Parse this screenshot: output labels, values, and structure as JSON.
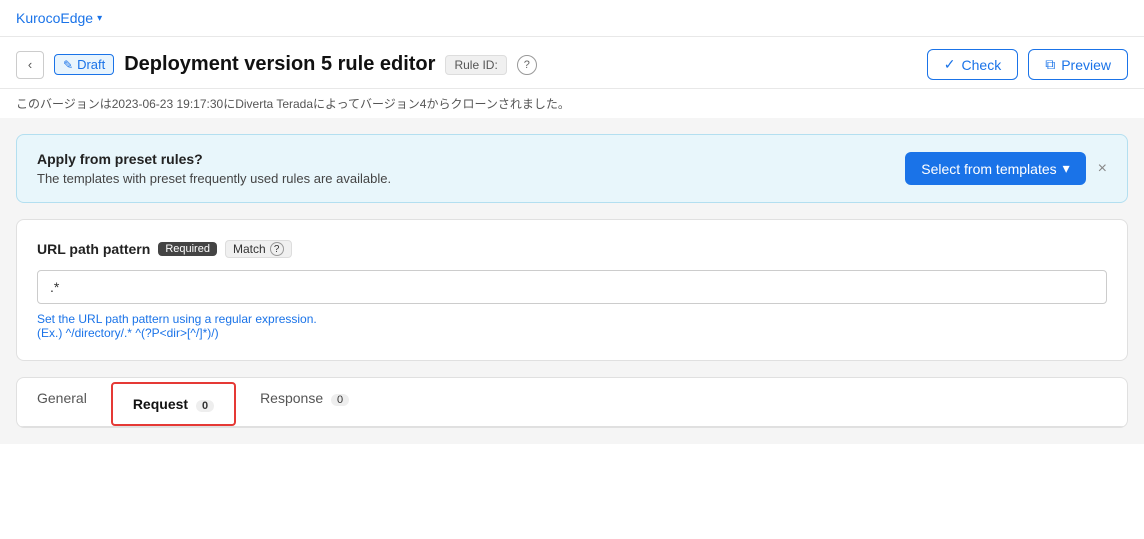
{
  "brand": {
    "name": "KurocoEdge",
    "chevron": "▾"
  },
  "header": {
    "back_label": "‹",
    "draft_label": "Draft",
    "draft_icon": "✎",
    "title": "Deployment version 5 rule editor",
    "rule_id_label": "Rule ID:",
    "help_icon": "?",
    "check_label": "Check",
    "check_icon": "✓",
    "preview_label": "Preview",
    "preview_icon": "⧉"
  },
  "version_info": "このバージョンは2023-06-23 19:17:30にDiverta Teradaによってバージョン4からクローンされました。",
  "template_banner": {
    "heading": "Apply from preset rules?",
    "description": "The templates with preset frequently used rules are available.",
    "select_btn_label": "Select from templates",
    "select_btn_chevron": "▾",
    "close_icon": "×"
  },
  "url_pattern": {
    "label": "URL path pattern",
    "required_badge": "Required",
    "match_label": "Match",
    "help_icon": "?",
    "input_value": ".*",
    "hint_line1": "Set the URL path pattern using a regular expression.",
    "hint_line2": "(Ex.)  ^/directory/.*   ^(?P<dir>[^/]*)/)"
  },
  "tabs": [
    {
      "id": "general",
      "label": "General",
      "badge": null,
      "active": false,
      "highlighted": false
    },
    {
      "id": "request",
      "label": "Request",
      "badge": "0",
      "active": false,
      "highlighted": true
    },
    {
      "id": "response",
      "label": "Response",
      "badge": "0",
      "active": false,
      "highlighted": false
    }
  ]
}
